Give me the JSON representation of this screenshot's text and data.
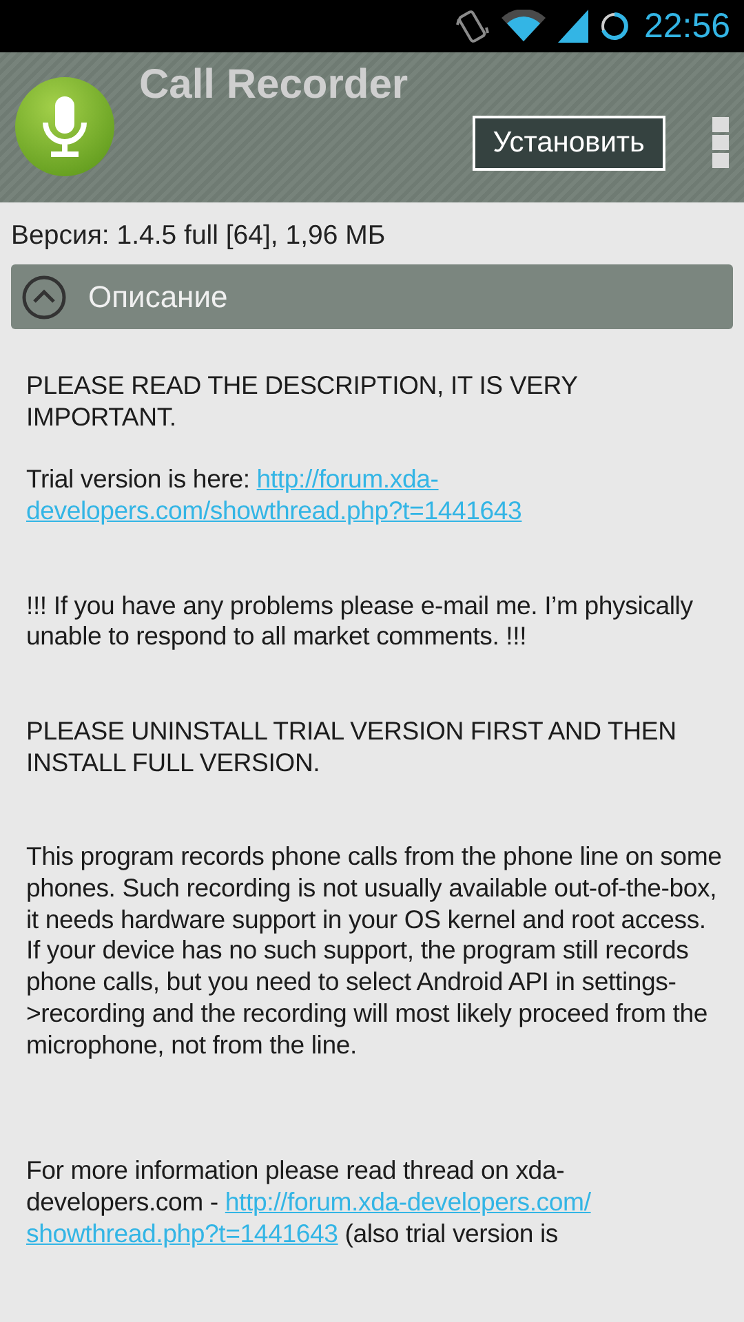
{
  "status_bar": {
    "time": "22:56"
  },
  "app": {
    "title": "Call Recorder",
    "install_button": "Установить"
  },
  "version": "Версия: 1.4.5 full [64], 1,96 МБ",
  "section": {
    "title": "Описание",
    "expanded": true
  },
  "description": [
    {
      "kind": "text",
      "text": "PLEASE READ THE DESCRIPTION, IT IS VERY IMPORTANT.\n\nTrial version is here: "
    },
    {
      "kind": "link",
      "text": "http://forum.xda-"
    },
    {
      "kind": "link",
      "text": "developers.com/showthread.php?t=1441643"
    },
    {
      "kind": "text",
      "text": "\n\n\n!!! If you have any problems please e-mail me. I’m physically unable to respond to all market comments. !!!\n\n\nPLEASE UNINSTALL TRIAL VERSION FIRST AND THEN INSTALL FULL VERSION.\n\n\nThis program records phone calls from the phone line on some phones. Such recording is not usually available out-of-the-box, it needs hardware support in your OS kernel and root access. If your device has no such support, the program still records phone calls, but you need to select Android API in settings->recording and the recording will most likely proceed from the microphone, not from the line.\n\n\n\nFor more information please read thread on xda-developers.com - "
    },
    {
      "kind": "link",
      "text": "http://forum.xda-developers.com/"
    },
    {
      "kind": "link",
      "text": "showthread.php?t=1441643"
    },
    {
      "kind": "text",
      "text": " (also trial version is"
    }
  ]
}
